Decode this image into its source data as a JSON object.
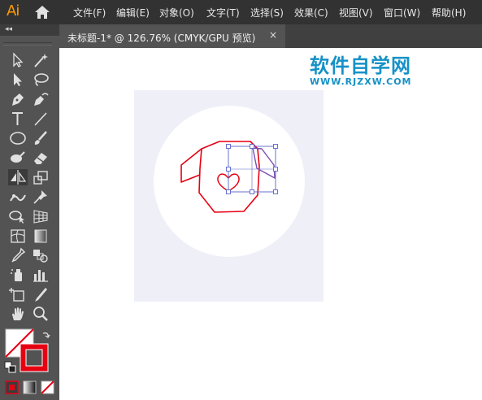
{
  "app": {
    "logo": "Ai"
  },
  "menu": {
    "items": [
      {
        "label": "文件(F)"
      },
      {
        "label": "编辑(E)"
      },
      {
        "label": "对象(O)"
      },
      {
        "label": "文字(T)"
      },
      {
        "label": "选择(S)"
      },
      {
        "label": "效果(C)"
      },
      {
        "label": "视图(V)"
      },
      {
        "label": "窗口(W)"
      },
      {
        "label": "帮助(H)"
      }
    ]
  },
  "document_tab": {
    "label": "未标题-1* @ 126.76% (CMYK/GPU 预览)",
    "close_glyph": "×"
  },
  "toolbar": {
    "collapse_glyph": "◂◂",
    "tools": [
      "selection-tool",
      "direct-selection-tool",
      "magic-wand-tool",
      "lasso-tool",
      "pen-tool",
      "curvature-tool",
      "type-tool",
      "line-tool",
      "ellipse-tool",
      "paintbrush-tool",
      "shaper-tool",
      "eraser-tool",
      "reflect-tool",
      "scale-tool",
      "puppet-warp-tool",
      "pin-tool",
      "shape-builder-tool",
      "perspective-grid-tool",
      "mesh-tool",
      "gradient-tool",
      "eyedropper-tool",
      "blend-tool",
      "symbol-sprayer-tool",
      "column-graph-tool",
      "artboard-tool",
      "slice-tool",
      "hand-tool",
      "zoom-tool"
    ],
    "fill_color": "#ffffff",
    "stroke_color": "#e60012"
  },
  "watermark": {
    "title": "软件自学网",
    "url": "WWW.RJZXW.COM"
  },
  "artwork": {
    "artboard_color": "#efeff8",
    "circle_color": "#ffffff",
    "shirt_stroke": "#e60012",
    "selection_color": "#5a63c9"
  }
}
